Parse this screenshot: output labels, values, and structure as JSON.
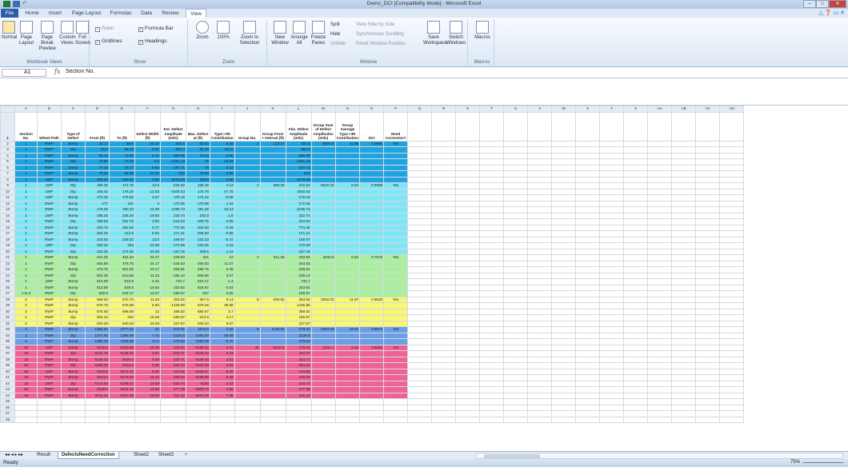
{
  "window": {
    "title": "Demo_DCI  [Compatibility Mode]  -  Microsoft Excel",
    "minimize": "–",
    "maximize": "□",
    "close": "✕"
  },
  "tabs": [
    {
      "label": "File"
    },
    {
      "label": "Home"
    },
    {
      "label": "Insert"
    },
    {
      "label": "Page Layout"
    },
    {
      "label": "Formulas"
    },
    {
      "label": "Data"
    },
    {
      "label": "Review"
    },
    {
      "label": "View"
    }
  ],
  "active_tab": "View",
  "ribbon": {
    "workbook_views": {
      "label": "Workbook Views",
      "normal": "Normal",
      "page_layout": "Page Layout",
      "page_break": "Page Break Preview",
      "custom_views": "Custom Views",
      "full_screen": "Full Screen"
    },
    "show": {
      "label": "Show",
      "ruler": "Ruler",
      "formula_bar": "Formula Bar",
      "gridlines": "Gridlines",
      "headings": "Headings"
    },
    "zoom": {
      "label": "Zoom",
      "zoom": "Zoom",
      "hundred": "100%",
      "zoom_to_selection": "Zoom to Selection"
    },
    "window": {
      "label": "Window",
      "new_window": "New Window",
      "arrange_all": "Arrange All",
      "freeze_panes": "Freeze Panes",
      "split": "Split",
      "hide": "Hide",
      "unhide": "Unhide",
      "side_by_side": "View Side by Side",
      "sync_scroll": "Synchronous Scrolling",
      "reset_pos": "Reset Window Position",
      "save_workspace": "Save Workspace",
      "switch_windows": "Switch Windows"
    },
    "macros": {
      "label": "Macros",
      "macros": "Macros"
    }
  },
  "formula_bar": {
    "cell_ref": "A1",
    "fx": "fx",
    "value": "Section No."
  },
  "columns": [
    "A",
    "B",
    "C",
    "D",
    "E",
    "F",
    "G",
    "H",
    "I",
    "J",
    "K",
    "L",
    "M",
    "N",
    "O",
    "P",
    "Q",
    "R",
    "S",
    "T",
    "U",
    "V",
    "W",
    "X",
    "Y",
    "Z",
    "AA",
    "AB",
    "AC",
    "AD"
  ],
  "header_row": [
    "Section No.",
    "Wheel Path",
    "Type of Defect",
    "From (ft)",
    "To (ft)",
    "Defect Width (ft)",
    "Est. Defect Amplitude (mils)",
    "Max. Defect at (ft)",
    "Type I IRI Contribution",
    "Group No.",
    "Group From + Interval (ft)",
    "Abs. Defect Amplitude (mils)",
    "Group Sum of Defect Amplitudes (mils)",
    "Group Average Type I IRI Contribution",
    "DCI",
    "Need Correction?"
  ],
  "rows": [
    {
      "b": "blue",
      "c": [
        "1",
        "RWP",
        "Bump",
        "33.17",
        "58.5",
        "25.33",
        "202.5",
        "50.83",
        "5.66",
        "1",
        "133.17",
        "202.5",
        "5800.9",
        "11.86",
        "0.9996",
        "Yes"
      ]
    },
    {
      "b": "blue",
      "c": [
        "1",
        "RWP",
        "Dip",
        "58.5",
        "68.42",
        "9.92",
        "-964.3",
        "65.25",
        "19.51",
        "",
        "",
        "964.3",
        "",
        "",
        "",
        ""
      ]
    },
    {
      "b": "blue",
      "c": [
        "1",
        "RWP",
        "Bump",
        "68.42",
        "73.83",
        "5.41",
        "390.69",
        "70.83",
        "8.58",
        "",
        "",
        "390.69",
        "",
        "",
        "",
        ""
      ]
    },
    {
      "b": "blue",
      "c": [
        "1",
        "RWP",
        "Dip",
        "73.83",
        "77.33",
        "3.5",
        "-1351.24",
        "75",
        "16.04",
        "",
        "",
        "1351.24",
        "",
        "",
        "",
        ""
      ]
    },
    {
      "b": "blue",
      "c": [
        "1",
        "RWP",
        "Bump",
        "77.33",
        "78.17",
        "0.84",
        "197.71",
        "78",
        "0.03",
        "",
        "",
        "197.71",
        "",
        "",
        "",
        ""
      ]
    },
    {
      "b": "blue",
      "c": [
        "1",
        "RWP",
        "Bump",
        "78.33",
        "89.08",
        "10.83",
        "616",
        "79.83",
        "8.96",
        "",
        "",
        "616",
        "",
        "",
        "",
        ""
      ]
    },
    {
      "b": "blue",
      "c": [
        "1",
        "LWP",
        "Bump",
        "108.33",
        "108.92",
        "0.59",
        "2078.49",
        "108.5",
        "3.86",
        "",
        "",
        "2078.49",
        "",
        "",
        "",
        ""
      ]
    },
    {
      "b": "cyan",
      "c": [
        "1",
        "LWP",
        "Dip",
        "158.25",
        "171.75",
        "13.5",
        "-232.62",
        "165.25",
        "4.13",
        "2",
        "258.25",
        "232.62",
        "6520.22",
        "8.53",
        "0.9999",
        "Yes"
      ]
    },
    {
      "b": "cyan",
      "c": [
        "1",
        "LWP",
        "Dip",
        "165.42",
        "178.25",
        "12.83",
        "-1840.53",
        "175.75",
        "47.75",
        "",
        "",
        "1840.53",
        "",
        "",
        "",
        ""
      ]
    },
    {
      "b": "cyan",
      "c": [
        "1",
        "LWP",
        "Bump",
        "172.25",
        "176.92",
        "4.67",
        "176.19",
        "174.42",
        "-0.69",
        "",
        "",
        "176.19",
        "",
        "",
        "",
        ""
      ]
    },
    {
      "b": "cyan",
      "c": [
        "1",
        "RWP",
        "Bump",
        "177",
        "181",
        "4",
        "172.56",
        "178.08",
        "1.34",
        "",
        "",
        "172.56",
        "",
        "",
        "",
        ""
      ]
    },
    {
      "b": "cyan",
      "c": [
        "1",
        "RWP",
        "Bump",
        "178.25",
        "190.33",
        "12.08",
        "2185.73",
        "181.25",
        "43.13",
        "",
        "",
        "2185.73",
        "",
        "",
        "",
        ""
      ]
    },
    {
      "b": "cyan",
      "c": [
        "1",
        "LWP",
        "Bump",
        "186.33",
        "206.25",
        "19.92",
        "222.74",
        "192.5",
        "1.9",
        "",
        "",
        "222.74",
        "",
        "",
        "",
        ""
      ]
    },
    {
      "b": "cyan",
      "c": [
        "1",
        "RWP",
        "Dip",
        "198.83",
        "202.75",
        "3.92",
        "-224.53",
        "200.75",
        "3.05",
        "",
        "",
        "224.53",
        "",
        "",
        "",
        ""
      ]
    },
    {
      "b": "cyan",
      "c": [
        "1",
        "RWP",
        "Bump",
        "202.75",
        "202.92",
        "0.17",
        "774.36",
        "202.83",
        "-0.29",
        "",
        "",
        "774.36",
        "",
        "",
        "",
        ""
      ]
    },
    {
      "b": "cyan",
      "c": [
        "1",
        "RWP",
        "Bump",
        "204.25",
        "212.5",
        "8.25",
        "171.21",
        "205.83",
        "-0.65",
        "",
        "",
        "171.21",
        "",
        "",
        "",
        ""
      ]
    },
    {
      "b": "cyan",
      "c": [
        "1",
        "RWP",
        "Bump",
        "215.83",
        "229.33",
        "13.5",
        "169.97",
        "222.33",
        "-0.47",
        "",
        "",
        "169.97",
        "",
        "",
        "",
        ""
      ]
    },
    {
      "b": "cyan",
      "c": [
        "1",
        "LWP",
        "Dip",
        "229.42",
        "253",
        "23.58",
        "-172.59",
        "232.25",
        "2.03",
        "",
        "",
        "172.59",
        "",
        "",
        "",
        ""
      ]
    },
    {
      "b": "cyan",
      "c": [
        "1",
        "RWP",
        "Dip",
        "232.25",
        "274.83",
        "42.58",
        "-157.19",
        "238.5",
        "1.12",
        "",
        "",
        "157.19",
        "",
        "",
        "",
        ""
      ]
    },
    {
      "b": "green",
      "c": [
        "1",
        "RWP",
        "Bump",
        "431.25",
        "454.42",
        "23.17",
        "240.84",
        "441",
        "12",
        "4",
        "511.25",
        "240.84",
        "2043.5",
        "5.52",
        "0.7675",
        "Yes"
      ]
    },
    {
      "b": "green",
      "c": [
        "1",
        "RWP",
        "Dip",
        "454.58",
        "478.75",
        "24.17",
        "-244.53",
        "466.83",
        "11.27",
        "",
        "",
        "244.53",
        "",
        "",
        "",
        ""
      ]
    },
    {
      "b": "green",
      "c": [
        "1",
        "RWP",
        "Bump",
        "478.75",
        "501.92",
        "23.17",
        "205.81",
        "485.75",
        "6.49",
        "",
        "",
        "205.81",
        "",
        "",
        "",
        ""
      ]
    },
    {
      "b": "green",
      "c": [
        "1",
        "RWP",
        "Dip",
        "502.25",
        "513.58",
        "11.33",
        "-185.13",
        "506.92",
        "3.57",
        "",
        "",
        "185.13",
        "",
        "",
        "",
        ""
      ]
    },
    {
      "b": "green",
      "c": [
        "1",
        "LWP",
        "Bump",
        "510.08",
        "510.5",
        "0.42",
        "732.7",
        "510.17",
        "1.4",
        "",
        "",
        "732.7",
        "",
        "",
        "",
        ""
      ]
    },
    {
      "b": "green",
      "c": [
        "1",
        "RWP",
        "Bump",
        "513.58",
        "530.5",
        "16.92",
        "253.92",
        "524.67",
        "0.63",
        "",
        "",
        "253.92",
        "",
        "",
        "",
        ""
      ]
    },
    {
      "b": "green",
      "c": [
        "1 to 2",
        "RWP",
        "Dip",
        "530.5",
        "543.17",
        "12.67",
        "-180.57",
        "537",
        "3.25",
        "",
        "",
        "180.57",
        "",
        "",
        "",
        ""
      ]
    },
    {
      "b": "yellow",
      "c": [
        "2",
        "RWP",
        "Bump",
        "558.92",
        "570.75",
        "11.83",
        "363.82",
        "567.5",
        "5.14",
        "5",
        "638.92",
        "363.82",
        "2582.03",
        "11.87",
        "0.9533",
        "Yes"
      ]
    },
    {
      "b": "yellow",
      "c": [
        "2",
        "RWP",
        "Bump",
        "570.75",
        "576.58",
        "5.83",
        "-1430.85",
        "575.25",
        "36.68",
        "",
        "",
        "1430.85",
        "",
        "",
        "",
        ""
      ]
    },
    {
      "b": "yellow",
      "c": [
        "2",
        "RWP",
        "Bump",
        "576.58",
        "588.58",
        "12",
        "388.82",
        "580.67",
        "3.7",
        "",
        "",
        "388.82",
        "",
        "",
        "",
        ""
      ]
    },
    {
      "b": "yellow",
      "c": [
        "2",
        "RWP",
        "Dip",
        "604.42",
        "620",
        "15.58",
        "-180.97",
        "613.5",
        "4.17",
        "",
        "",
        "180.97",
        "",
        "",
        "",
        ""
      ]
    },
    {
      "b": "yellow",
      "c": [
        "2",
        "RWP",
        "Bump",
        "620.25",
        "640.33",
        "20.08",
        "227.57",
        "628.33",
        "9.67",
        "",
        "",
        "227.57",
        "",
        "",
        "",
        ""
      ]
    },
    {
      "b": "slate",
      "c": [
        "3",
        "RWP",
        "Bump",
        "1056.92",
        "1077.92",
        "21",
        "579.31",
        "1074.5",
        "4.32",
        "9",
        "1136.92",
        "579.31",
        "3284.54",
        "23.51",
        "0.9972",
        "Yes"
      ]
    },
    {
      "b": "slate",
      "c": [
        "3",
        "RWP",
        "Dip",
        "1077.92",
        "1085.08",
        "7.16",
        "-2226.8",
        "1081.67",
        "66.68",
        "",
        "",
        "2226.8",
        "",
        "",
        "",
        ""
      ]
    },
    {
      "b": "slate",
      "c": [
        "3",
        "RWP",
        "Bump",
        "1085.08",
        "1106.58",
        "21.5",
        "478.53",
        "1090.08",
        "-0.47",
        "",
        "",
        "478.53",
        "",
        "",
        "",
        ""
      ]
    },
    {
      "b": "pink",
      "c": [
        "18",
        "LWP",
        "Bump",
        "9130.5",
        "9140.58",
        "10.08",
        "178.02",
        "9138.42",
        "4.31",
        "30",
        "9210.5",
        "178.02",
        "2441.1",
        "5.34",
        "0.8646",
        "Yes"
      ]
    },
    {
      "b": "pink",
      "c": [
        "18",
        "RWP",
        "Dip",
        "9141.75",
        "9146.42",
        "4.67",
        "-203.47",
        "9144.42",
        "3.19",
        "",
        "",
        "203.47",
        "",
        "",
        "",
        ""
      ]
    },
    {
      "b": "pink",
      "c": [
        "18",
        "RWP",
        "Bump",
        "9146.42",
        "9155.5",
        "9.08",
        "243.71",
        "9149.42",
        "3.81",
        "",
        "",
        "243.71",
        "",
        "",
        "",
        ""
      ]
    },
    {
      "b": "pink",
      "c": [
        "18",
        "RWP",
        "Dip",
        "9155.92",
        "9164.5",
        "8.58",
        "-264.24",
        "9161.83",
        "6.64",
        "",
        "",
        "264.24",
        "",
        "",
        "",
        ""
      ]
    },
    {
      "b": "pink",
      "c": [
        "18",
        "LWP",
        "Bump",
        "9162.5",
        "9172.42",
        "9.92",
        "410.88",
        "9165.67",
        "8.29",
        "",
        "",
        "410.88",
        "",
        "",
        "",
        ""
      ]
    },
    {
      "b": "pink",
      "c": [
        "18",
        "RWP",
        "Bump",
        "9164.5",
        "9179.92",
        "15.42",
        "229.54",
        "9168.08",
        "9.49",
        "",
        "",
        "229.54",
        "",
        "",
        "",
        ""
      ]
    },
    {
      "b": "pink",
      "c": [
        "18",
        "LWP",
        "Dip",
        "9172.83",
        "9186.42",
        "13.59",
        "-316.74",
        "9180",
        "2.37",
        "",
        "",
        "316.74",
        "",
        "",
        "",
        ""
      ]
    },
    {
      "b": "pink",
      "c": [
        "18",
        "RWP",
        "Bump",
        "9198.5",
        "9211.42",
        "12.92",
        "277.38",
        "9206.75",
        "2.56",
        "",
        "",
        "277.38",
        "",
        "",
        "",
        ""
      ]
    },
    {
      "b": "pink",
      "c": [
        "18",
        "RWP",
        "Bump",
        "9211.42",
        "9227.25",
        "15.83",
        "311.12",
        "9216.25",
        "7.35",
        "",
        "",
        "311.12",
        "",
        "",
        "",
        ""
      ]
    }
  ],
  "empty_row_numbers": [
    "45",
    "46",
    "47",
    "48"
  ],
  "sheets": [
    {
      "label": "Result"
    },
    {
      "label": "DefectsNeedCorrection"
    },
    {
      "label": "Sheet2"
    },
    {
      "label": "Sheet3"
    }
  ],
  "active_sheet": "DefectsNeedCorrection",
  "status": {
    "ready": "Ready",
    "zoom": "75%"
  },
  "colors": {
    "blue": "#1fa4e0",
    "cyan": "#7fe6f5",
    "green": "#a9ef9e",
    "yellow": "#f7f775",
    "slate": "#6a9ee6",
    "pink": "#f06294"
  }
}
